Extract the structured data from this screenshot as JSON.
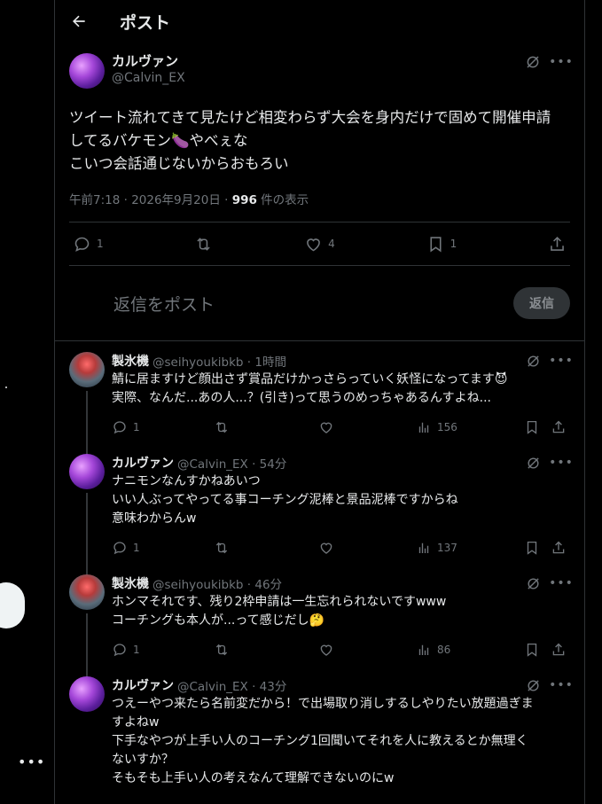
{
  "header": {
    "title": "ポスト"
  },
  "main_post": {
    "display_name": "カルヴァン",
    "handle": "@Calvin_EX",
    "text": "ツイート流れてきて見たけど相変わらず大会を身内だけで固めて開催申請\nしてるバケモン🍆やべぇな\nこいつ会話通じないからおもろい",
    "time": "午前7:18 · 2026年9月20日 · ",
    "views": "996",
    "views_suffix": " 件の表示",
    "replies": "1",
    "likes": "4",
    "bookmarks": "1"
  },
  "reply_composer": {
    "placeholder": "返信をポスト",
    "button": "返信"
  },
  "replies": [
    {
      "display_name": "製氷機",
      "handle_time": "@seihyoukibkb · 1時間",
      "text": "鯖に居ますけど顔出さず賞品だけかっさらっていく妖怪になってます😈\n実際、なんだ...あの人...？(引き)って思うのめっちゃあるんすよね...",
      "replies": "1",
      "views": "156"
    },
    {
      "display_name": "カルヴァン",
      "handle_time": "@Calvin_EX · 54分",
      "text": "ナニモンなんすかねあいつ\nいい人ぶってやってる事コーチング泥棒と景品泥棒ですからね\n意味わからんw",
      "replies": "1",
      "views": "137"
    },
    {
      "display_name": "製氷機",
      "handle_time": "@seihyoukibkb · 46分",
      "text": "ホンマそれです、残り2枠申請は一生忘れられないですwww\nコーチングも本人が...って感じだし🤔",
      "replies": "1",
      "views": "86"
    },
    {
      "display_name": "カルヴァン",
      "handle_time": "@Calvin_EX · 43分",
      "text": "つえーやつ来たら名前変だから！で出場取り消しするしやりたい放題過ぎま\nすよねw\n下手なやつが上手い人のコーチング1回聞いてそれを人に教えるとか無理く\nないすか？\nそもそも上手い人の考えなんて理解できないのにw",
      "replies": "",
      "views": ""
    }
  ]
}
